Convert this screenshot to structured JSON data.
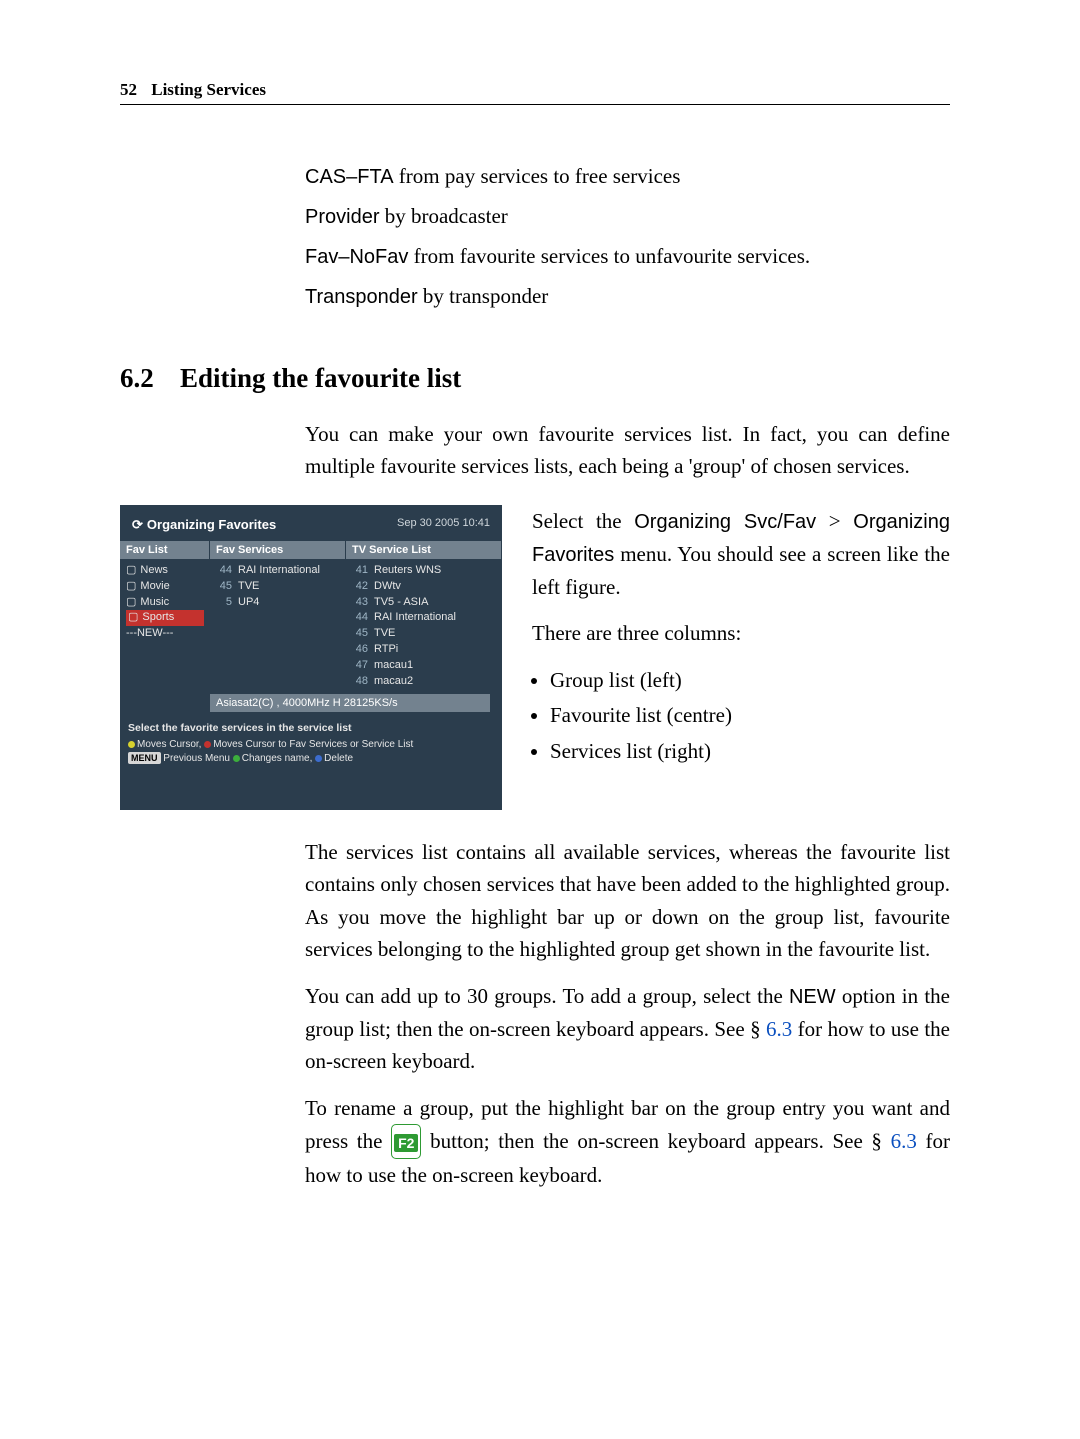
{
  "header": {
    "page_number": "52",
    "chapter": "Listing Services"
  },
  "defs": [
    {
      "term": "CAS–FTA",
      "desc": "from pay services to free services"
    },
    {
      "term": "Provider",
      "desc": "by broadcaster"
    },
    {
      "term": "Fav–NoFav",
      "desc": "from favourite services to unfavourite services."
    },
    {
      "term": "Transponder",
      "desc": "by transponder"
    }
  ],
  "section": {
    "number": "6.2",
    "title": "Editing the favourite list"
  },
  "intro": "You can make your own favourite services list. In fact, you can define multiple favourite services lists, each being a 'group' of chosen services.",
  "screenshot": {
    "window_title": "Organizing Favorites",
    "timestamp": "Sep 30 2005 10:41",
    "headers": {
      "fav_list": "Fav List",
      "fav_services": "Fav Services",
      "tv_service_list": "TV Service List"
    },
    "fav_list": [
      {
        "label": "News",
        "selected": false
      },
      {
        "label": "Movie",
        "selected": false
      },
      {
        "label": "Music",
        "selected": false
      },
      {
        "label": "Sports",
        "selected": true
      },
      {
        "label": "---NEW---",
        "selected": false,
        "is_new": true
      }
    ],
    "fav_services": [
      {
        "n": "44",
        "name": "RAI International"
      },
      {
        "n": "45",
        "name": "TVE"
      },
      {
        "n": "5",
        "name": "UP4"
      }
    ],
    "tv_services": [
      {
        "n": "41",
        "name": "Reuters WNS"
      },
      {
        "n": "42",
        "name": "DWtv"
      },
      {
        "n": "43",
        "name": "TV5 - ASIA"
      },
      {
        "n": "44",
        "name": "RAI International"
      },
      {
        "n": "45",
        "name": "TVE"
      },
      {
        "n": "46",
        "name": "RTPi"
      },
      {
        "n": "47",
        "name": "macau1"
      },
      {
        "n": "48",
        "name": "macau2"
      }
    ],
    "transponder_line": "Asiasat2(C) , 4000MHz H 28125KS/s",
    "help_title": "Select the favorite services in the service list",
    "help_line_parts": {
      "moves_cursor": "Moves Cursor,",
      "moves_to": "Moves Cursor to Fav Services or Service List",
      "prev_menu_key": "MENU",
      "prev_menu": "Previous Menu",
      "changes_name": "Changes name,",
      "delete": "Delete"
    }
  },
  "right_side": {
    "p1a": "Select the ",
    "p1b": "Organizing Svc/Fav",
    "p1c": " > ",
    "p1d": "Organizing Favorites",
    "p1e": " menu. You should see a screen like the left figure.",
    "p2": "There are three columns:",
    "bullets": [
      "Group list (left)",
      "Favourite list (centre)",
      "Services list (right)"
    ]
  },
  "after": {
    "p1": "The services list contains all available services, whereas the favourite list contains only chosen services that have been added to the highlighted group. As you move the highlight bar up or down on the group list, favourite services belonging to the highlighted group get shown in the favourite list.",
    "p2a": "You can add up to 30 groups. To add a group, select the ",
    "p2b": "NEW",
    "p2c": " option in the group list; then the on-screen keyboard appears. See § ",
    "p2d": "6.3",
    "p2e": " for how to use the on-screen keyboard.",
    "p3a": "To rename a group, put the highlight bar on the group entry you want and press the ",
    "p3_key": "F2",
    "p3b": " button; then the on-screen keyboard appears. See § ",
    "p3c": "6.3",
    "p3d": " for how to use the on-screen keyboard."
  }
}
